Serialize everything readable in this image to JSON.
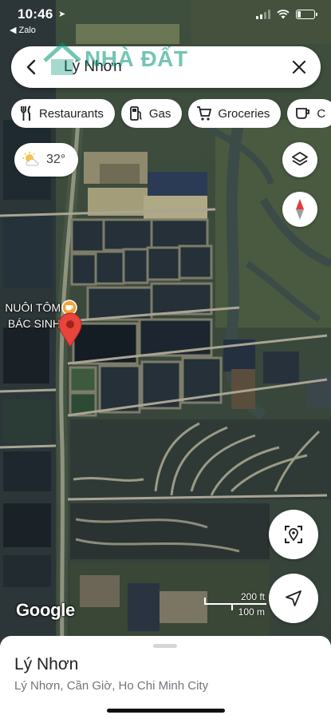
{
  "status_bar": {
    "time": "10:46",
    "back_app": "◀ Zalo",
    "battery_level": 0.2
  },
  "search": {
    "query": "Lý Nhơn",
    "watermark": "NHÀ ĐẤT"
  },
  "chips": [
    {
      "label": "Restaurants",
      "icon": "restaurant-icon"
    },
    {
      "label": "Gas",
      "icon": "gas-pump-icon"
    },
    {
      "label": "Groceries",
      "icon": "cart-icon"
    },
    {
      "label": "C",
      "icon": "coffee-icon"
    }
  ],
  "weather": {
    "temp": "32°",
    "icon": "sun-cloud-icon"
  },
  "poi": {
    "line1": "NUÔI TÔM",
    "line2": "BÁC SINH"
  },
  "attribution": "Google",
  "scale": {
    "feet": "200 ft",
    "meters": "100 m"
  },
  "place": {
    "title": "Lý Nhơn",
    "subtitle": "Lý Nhơn, Cần Giờ, Ho Chi Minh City"
  },
  "colors": {
    "pin_red": "#e8453c",
    "poi_orange": "#f2a33a",
    "compass_red": "#e53935"
  }
}
